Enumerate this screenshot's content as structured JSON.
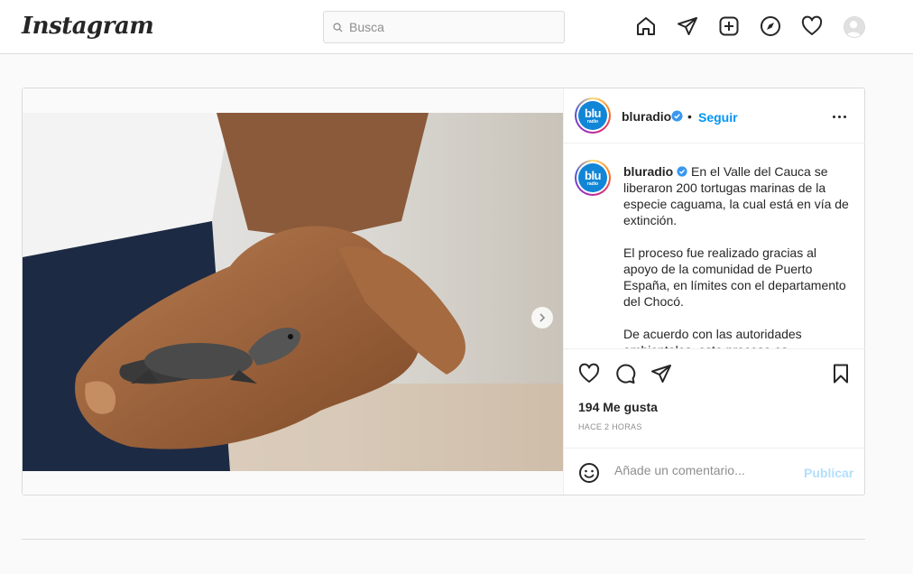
{
  "app": {
    "logo_text": "Instagram"
  },
  "search": {
    "placeholder": "Busca"
  },
  "nav": {
    "icons": [
      "home-icon",
      "direct-send-icon",
      "new-post-icon",
      "explore-compass-icon",
      "activity-heart-icon",
      "profile-avatar"
    ]
  },
  "post": {
    "account": "bluradio",
    "separator": "•",
    "follow_label": "Seguir",
    "avatar_text": "blu",
    "avatar_subtext": "radio",
    "carousel": {
      "slides": 7,
      "active_index": 0
    },
    "caption_paragraphs": [
      "En el Valle del Cauca se liberaron 200 tortugas marinas de la especie caguama, la cual está en vía de extinción.",
      "El proceso fue realizado gracias al apoyo de la comunidad de Puerto España, en límites con el departamento del Chocó.",
      "De acuerdo con las autoridades ambientales, este proceso es"
    ],
    "likes": "194 Me gusta",
    "timestamp": "HACE 2 HORAS",
    "comment_placeholder": "Añade un comentario...",
    "publish_label": "Publicar"
  },
  "colors": {
    "accent": "#0095f6",
    "publish_disabled": "#b2dffc",
    "verified": "#3897f0",
    "brand_avatar": "#1185d6"
  }
}
